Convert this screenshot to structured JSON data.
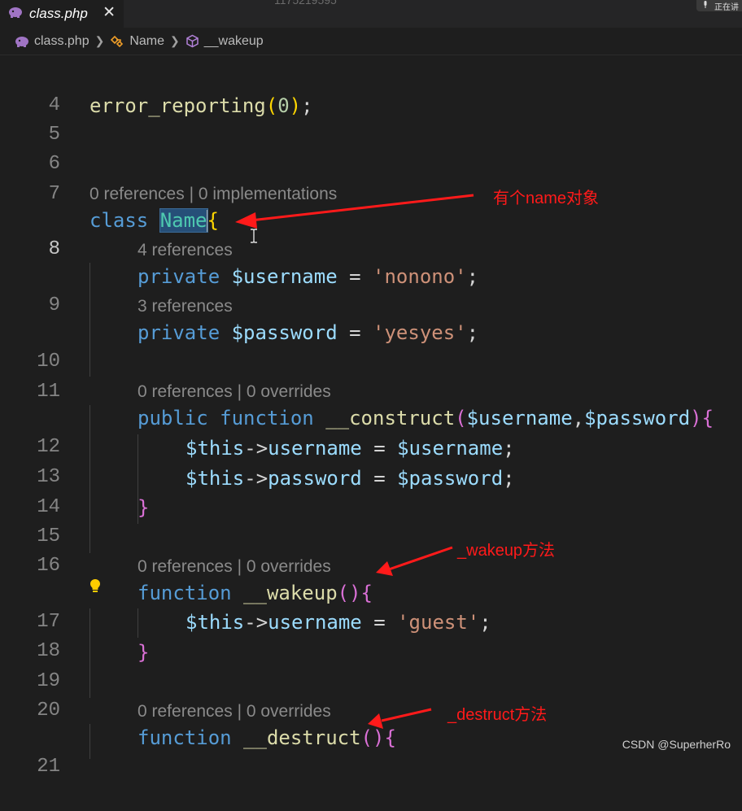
{
  "tab": {
    "filename": "class.php",
    "icon": "php-elephant-icon",
    "close": "✕"
  },
  "window": {
    "title_fragment": "1175219595",
    "right_text": "正在讲"
  },
  "breadcrumb": [
    "class.php",
    "Name",
    "__wakeup"
  ],
  "lines": {
    "l4": "4",
    "l5": "5",
    "l6": "6",
    "l7": "7",
    "l8": "8",
    "l9": "9",
    "l10": "10",
    "l11": "11",
    "l12": "12",
    "l13": "13",
    "l14": "14",
    "l15": "15",
    "l16": "16",
    "l17": "17",
    "l18": "18",
    "l19": "19",
    "l20": "20",
    "l21": "21"
  },
  "lens": {
    "class_name": "0 references | 0 implementations",
    "username": "4 references",
    "password": "3 references",
    "construct": "0 references | 0 overrides",
    "wakeup": "0 references | 0 overrides",
    "destruct": "0 references | 0 overrides"
  },
  "code": {
    "error_reporting": "error_reporting",
    "zero": "0",
    "kw_class": "class",
    "class_name": "Name",
    "kw_private": "private",
    "kw_public": "public",
    "kw_function": "function",
    "var_username": "$username",
    "var_password": "$password",
    "str_nonono": "'nonono'",
    "str_yesyes": "'yesyes'",
    "str_guest": "'guest'",
    "fn_construct": "__construct",
    "fn_wakeup": "__wakeup",
    "fn_destruct": "__destruct",
    "this": "$this",
    "prop_username": "username",
    "prop_password": "password"
  },
  "annotations": {
    "name_object": "有个name对象",
    "wakeup_method": "_wakeup方法",
    "destruct_method": "_destruct方法"
  },
  "colors": {
    "annotation": "#ff1a1a",
    "keyword": "#569cd6",
    "function": "#dcdcaa",
    "variable": "#9cdcfe",
    "string": "#ce9178",
    "class": "#4ec9b0"
  },
  "watermark": "CSDN @SuperherRo"
}
